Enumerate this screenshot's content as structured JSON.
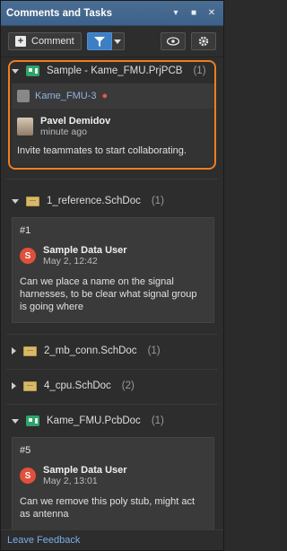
{
  "window": {
    "title": "Comments and Tasks"
  },
  "toolbar": {
    "comment_label": "Comment"
  },
  "project": {
    "name": "Sample - Kame_FMU.PrjPCB",
    "count": "(1)",
    "member": "Kame_FMU-3",
    "user": "Pavel Demidov",
    "time": "minute ago",
    "message": "Invite teammates to start collaborating."
  },
  "docs": [
    {
      "name": "1_reference.SchDoc",
      "count": "(1)"
    },
    {
      "name": "2_mb_conn.SchDoc",
      "count": "(1)"
    },
    {
      "name": "4_cpu.SchDoc",
      "count": "(2)"
    },
    {
      "name": "Kame_FMU.PcbDoc",
      "count": "(1)"
    }
  ],
  "comments": [
    {
      "num": "#1",
      "avatar": "S",
      "user": "Sample Data User",
      "date": "May 2, 12:42",
      "text": "Can we place a name on the signal harnesses, to be clear what signal group is going where"
    },
    {
      "num": "#5",
      "avatar": "S",
      "user": "Sample Data User",
      "date": "May 2, 13:01",
      "text": "Can we remove this poly stub, might act as antenna"
    }
  ],
  "footer": {
    "link": "Leave Feedback"
  },
  "colors": {
    "accent": "#3d7fc4",
    "highlight": "#f07d1e",
    "titlebar": "#4a6d93"
  }
}
